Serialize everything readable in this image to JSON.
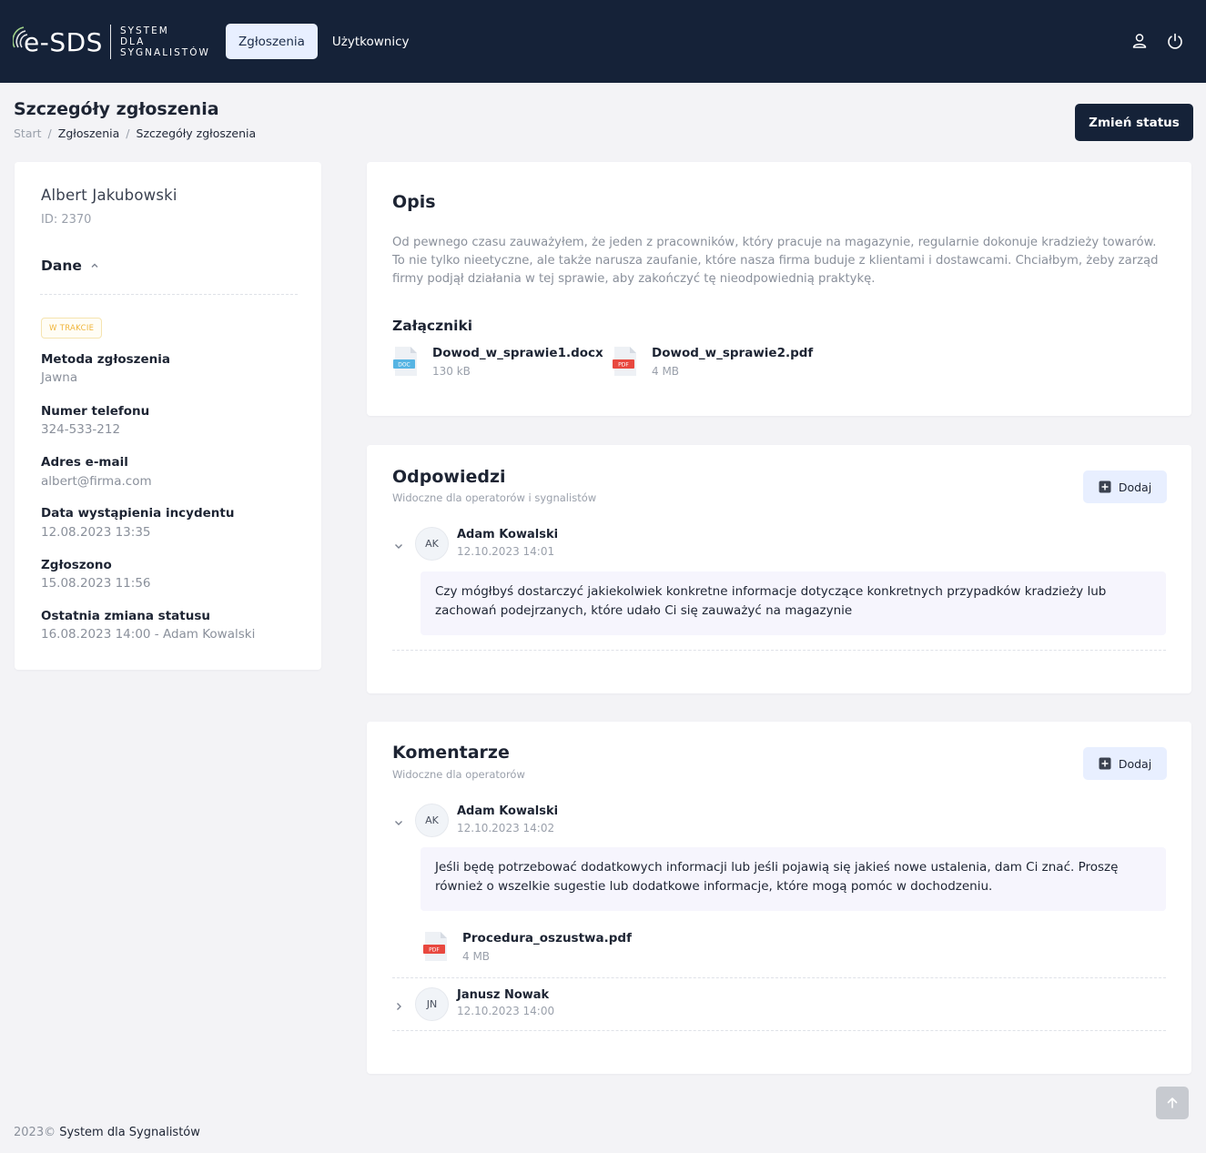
{
  "header": {
    "logo_text": "e-SDS",
    "logo_sub": [
      "SYSTEM",
      "DLA",
      "SYGNALISTÓW"
    ],
    "nav": [
      {
        "label": "Zgłoszenia",
        "active": true
      },
      {
        "label": "Użytkownicy",
        "active": false
      }
    ],
    "icons": [
      "user-icon",
      "power-icon"
    ]
  },
  "page": {
    "title": "Szczegóły zgłoszenia",
    "breadcrumb": [
      "Start",
      "Zgłoszenia",
      "Szczegóły zgłoszenia"
    ],
    "status_button": "Zmień status"
  },
  "reporter": {
    "name": "Albert Jakubowski",
    "id": "ID: 2370",
    "section_title": "Dane",
    "status_badge": "W TRAKCIE",
    "fields": [
      {
        "label": "Metoda zgłoszenia",
        "value": "Jawna"
      },
      {
        "label": "Numer telefonu",
        "value": "324-533-212"
      },
      {
        "label": "Adres e-mail",
        "value": "albert@firma.com"
      },
      {
        "label": "Data wystąpienia incydentu",
        "value": "12.08.2023 13:35"
      },
      {
        "label": "Zgłoszono",
        "value": "15.08.2023 11:56"
      },
      {
        "label": "Ostatnia zmiana statusu",
        "value": "16.08.2023 14:00 - Adam Kowalski"
      }
    ]
  },
  "description": {
    "title": "Opis",
    "text": "Od pewnego czasu zauważyłem, że jeden z pracowników, który pracuje na magazynie, regularnie dokonuje kradzieży towarów. To nie tylko nieetyczne, ale także narusza zaufanie, które nasza firma buduje z klientami i dostawcami. Chciałbym, żeby zarząd firmy podjął działania w tej sprawie, aby zakończyć tę nieodpowiednią praktykę.",
    "attachments_title": "Załączniki",
    "attachments": [
      {
        "name": "Dowod_w_sprawie1.docx",
        "size": "130 kB",
        "type": "DOC"
      },
      {
        "name": "Dowod_w_sprawie2.pdf",
        "size": "4 MB",
        "type": "PDF"
      }
    ]
  },
  "responses": {
    "title": "Odpowiedzi",
    "subtitle": "Widoczne dla operatorów i sygnalistów",
    "add_label": "Dodaj",
    "items": [
      {
        "initials": "AK",
        "author": "Adam Kowalski",
        "date": "12.10.2023 14:01",
        "text": "Czy mógłbyś dostarczyć jakiekolwiek konkretne informacje dotyczące konkretnych przypadków kradzieży lub zachowań podejrzanych, które udało Ci się zauważyć na magazynie"
      }
    ]
  },
  "comments": {
    "title": "Komentarze",
    "subtitle": "Widoczne dla operatorów",
    "add_label": "Dodaj",
    "items": [
      {
        "initials": "AK",
        "author": "Adam Kowalski",
        "date": "12.10.2023 14:02",
        "text": "Jeśli będę potrzebować dodatkowych informacji lub jeśli pojawią się jakieś nowe ustalenia, dam Ci znać. Proszę również o wszelkie sugestie lub dodatkowe informacje, które mogą pomóc w dochodzeniu.",
        "attachment": {
          "name": "Procedura_oszustwa.pdf",
          "size": "4 MB",
          "type": "PDF"
        }
      },
      {
        "initials": "JN",
        "author": "Janusz Nowak",
        "date": "12.10.2023 14:00"
      }
    ]
  },
  "footer": {
    "year": "2023©",
    "text": "System dla Sygnalistów"
  }
}
